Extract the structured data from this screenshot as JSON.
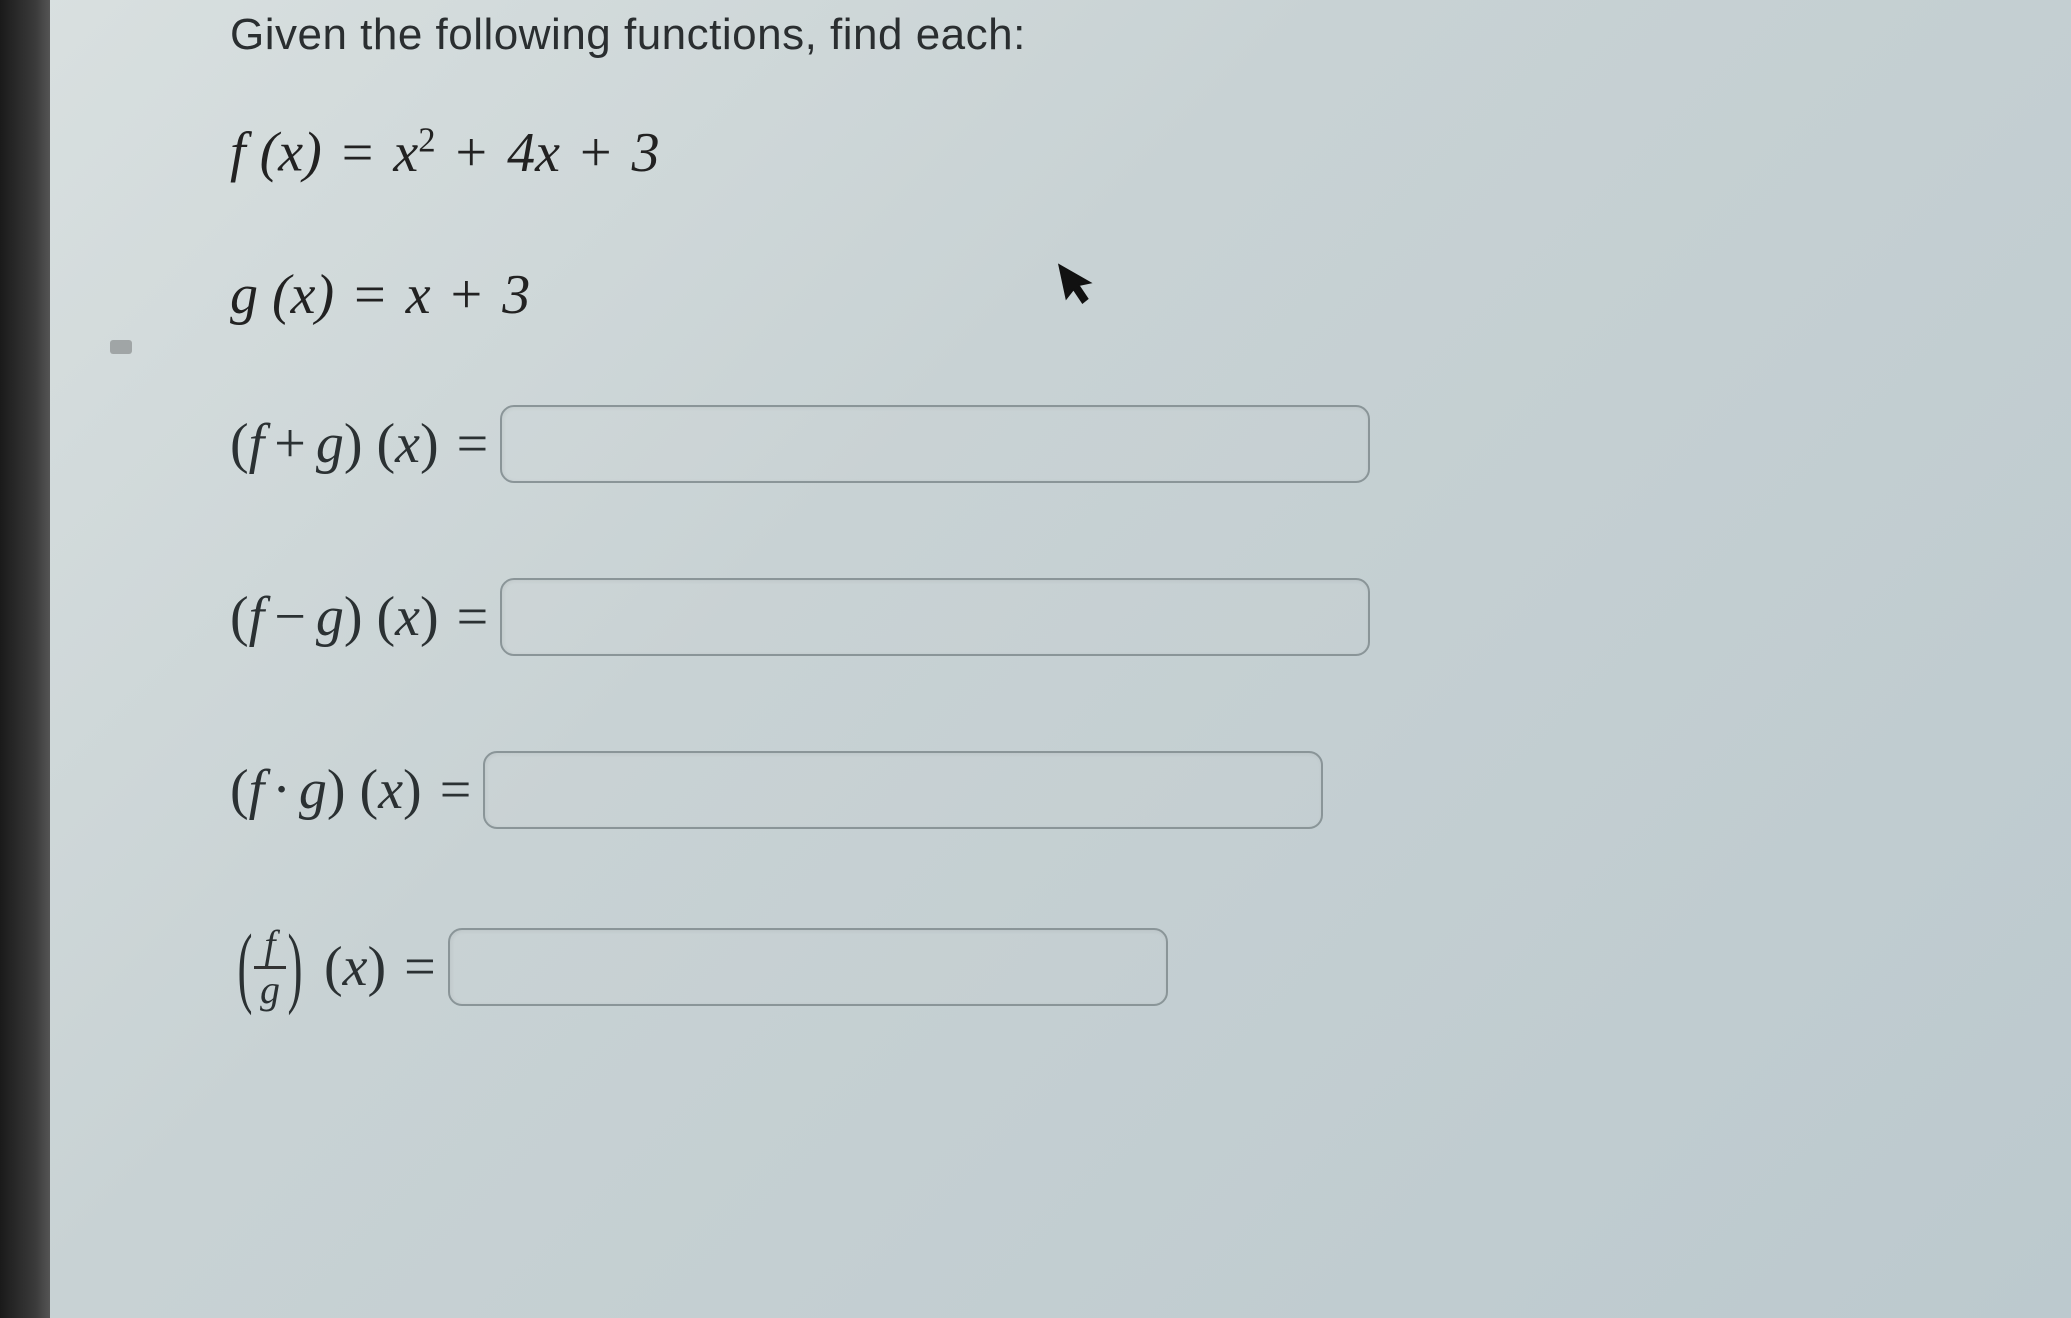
{
  "instruction": "Given the following functions, find each:",
  "definitions": {
    "f": {
      "lhs_fn": "f",
      "lhs_var": "x",
      "rhs_html": "x² + 4x + 3"
    },
    "g": {
      "lhs_fn": "g",
      "lhs_var": "x",
      "rhs_html": "x + 3"
    }
  },
  "questions": {
    "sum": {
      "label_op": "+",
      "value": ""
    },
    "difference": {
      "label_op": "−",
      "value": ""
    },
    "product": {
      "label_op": "·",
      "value": ""
    },
    "quotient": {
      "num": "f",
      "den": "g",
      "value": ""
    }
  },
  "symbols": {
    "fn_f": "f",
    "fn_g": "g",
    "var_x": "x",
    "open": "(",
    "close": ")",
    "equals": "="
  }
}
